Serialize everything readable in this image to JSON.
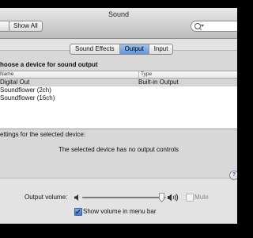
{
  "window": {
    "title": "Sound"
  },
  "toolbar": {
    "show_all_label": "Show All",
    "search_placeholder": ""
  },
  "tabs": [
    {
      "label": "Sound Effects",
      "active": false
    },
    {
      "label": "Output",
      "active": true
    },
    {
      "label": "Input",
      "active": false
    }
  ],
  "output": {
    "heading": "hoose a device for sound output",
    "columns": {
      "name": "Name",
      "type": "Type"
    },
    "devices": [
      {
        "name": "Digital Out",
        "type": "Built-in Output",
        "selected": true
      },
      {
        "name": "Soundflower (2ch)",
        "type": "",
        "selected": false
      },
      {
        "name": "Soundflower (16ch)",
        "type": "",
        "selected": false
      }
    ],
    "settings_label": "ettings for the selected device:",
    "no_controls_message": "The selected device has no output controls"
  },
  "help": {
    "glyph": "?"
  },
  "volume": {
    "label": "Output volume:",
    "level": 0.95,
    "mute_label": "Mute",
    "mute_checked": false,
    "show_in_menu_bar_label": "Show volume in menu bar",
    "show_in_menu_bar_checked": true
  },
  "colors": {
    "selection_accent": "#5e96dc",
    "checkbox_blue": "#3b78c9"
  }
}
